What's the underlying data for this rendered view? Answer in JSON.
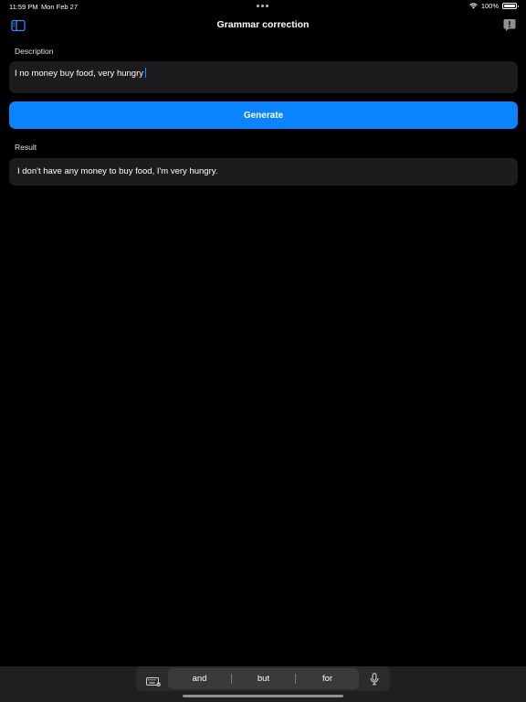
{
  "status_bar": {
    "time": "11:59 PM",
    "date": "Mon Feb 27",
    "battery": "100%",
    "wifi_icon": "wifi-icon",
    "battery_icon": "battery-icon"
  },
  "nav": {
    "title": "Grammar correction",
    "left_icon": "sidebar-toggle-icon",
    "right_icon": "feedback-icon"
  },
  "form": {
    "description_label": "Description",
    "description_value": "I no money buy food, very hungry",
    "generate_label": "Generate",
    "result_label": "Result",
    "result_value": "I don't have any money to buy food, I'm very hungry."
  },
  "keyboard": {
    "suggestions": [
      "and",
      "but",
      "for"
    ],
    "left_icon": "keyboard-icon",
    "right_icon": "microphone-icon"
  },
  "colors": {
    "background": "#000000",
    "field": "#1c1c1e",
    "accent": "#0a84ff",
    "sidebar_icon": "#2f88ff"
  }
}
